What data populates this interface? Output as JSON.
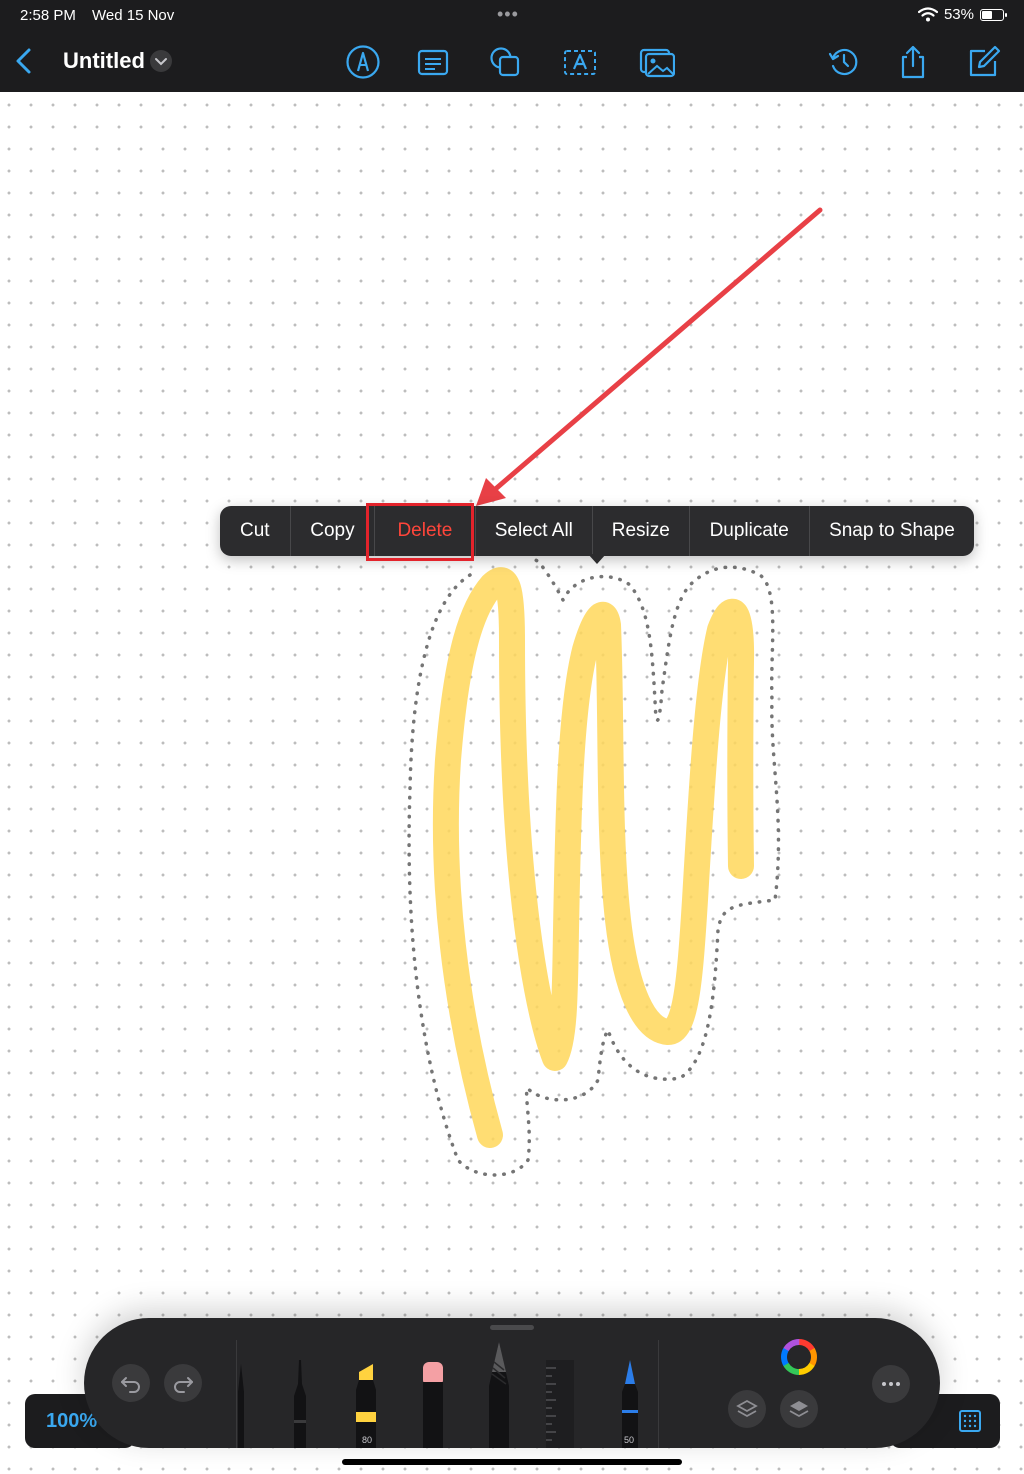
{
  "status_bar": {
    "time": "2:58 PM",
    "date": "Wed 15 Nov",
    "battery": "53%",
    "battery_level": 0.53,
    "wifi_icon": "wifi-icon"
  },
  "header": {
    "title": "Untitled",
    "tool_icons": [
      "pen-tool-icon",
      "sticky-note-icon",
      "shapes-icon",
      "text-box-icon",
      "image-icon"
    ],
    "right_icons": [
      "history-icon",
      "share-icon",
      "compose-icon"
    ]
  },
  "context_menu": {
    "items": [
      {
        "label": "Cut"
      },
      {
        "label": "Copy"
      },
      {
        "label": "Delete",
        "destructive": true
      },
      {
        "label": "Select All"
      },
      {
        "label": "Resize"
      },
      {
        "label": "Duplicate"
      },
      {
        "label": "Snap to Shape"
      }
    ]
  },
  "annotation": {
    "highlight_color": "#e3232b",
    "arrow_color": "#e84046"
  },
  "drawing": {
    "stroke_color": "#ffd75a",
    "selection": "dotted lasso outline"
  },
  "bottom_bar": {
    "zoom": "100%",
    "highlighter_size": "80",
    "pen_size": "50",
    "colors": {
      "accent": "#3aa8f0",
      "highlighter": "#ffd23f",
      "eraser": "#f4a0a4",
      "fountain_pen": "#2b7de9"
    }
  }
}
